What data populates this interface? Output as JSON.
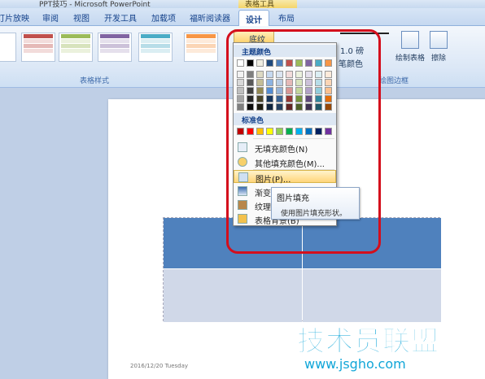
{
  "titlebar": {
    "title": "PPT技巧 - Microsoft PowerPoint",
    "contextual_tab_group": "表格工具"
  },
  "tabs": [
    "灯片放映",
    "审阅",
    "视图",
    "开发工具",
    "加载项",
    "福昕阅读器",
    "设计",
    "布局"
  ],
  "active_tab": "设计",
  "ribbon": {
    "table_styles_label": "表格样式",
    "shading_button": "底纹",
    "pen_weight": "1.0 磅",
    "pen_color": "笔颜色",
    "draw_table": "绘制表格",
    "eraser": "擦除",
    "draw_borders_label": "绘图边框"
  },
  "shading_menu": {
    "theme_colors_heading": "主题颜色",
    "theme_colors": [
      [
        "#ffffff",
        "#000000",
        "#eeece1",
        "#1f497d",
        "#4f81bd",
        "#c0504d",
        "#9bbb59",
        "#8064a2",
        "#4bacc6",
        "#f79646"
      ],
      [
        "#f2f2f2",
        "#7f7f7f",
        "#ddd9c3",
        "#c6d9f0",
        "#dbe5f1",
        "#f2dcdb",
        "#ebf1dd",
        "#e5e0ec",
        "#dbeef3",
        "#fdeada"
      ],
      [
        "#d8d8d8",
        "#595959",
        "#c4bd97",
        "#8db3e2",
        "#b8cce4",
        "#e5b9b7",
        "#d7e3bc",
        "#ccc1d9",
        "#b7dde8",
        "#fbd5b5"
      ],
      [
        "#bfbfbf",
        "#3f3f3f",
        "#938953",
        "#548dd4",
        "#95b3d7",
        "#d99694",
        "#c3d69b",
        "#b2a2c7",
        "#92cddc",
        "#fac08f"
      ],
      [
        "#a5a5a5",
        "#262626",
        "#494429",
        "#17365d",
        "#366092",
        "#953734",
        "#76923c",
        "#5f497a",
        "#31859b",
        "#e36c09"
      ],
      [
        "#7f7f7f",
        "#0c0c0c",
        "#1d1b10",
        "#0f243e",
        "#244061",
        "#632423",
        "#4f6128",
        "#3f3151",
        "#205867",
        "#974806"
      ]
    ],
    "standard_colors_heading": "标准色",
    "standard_colors": [
      "#c00000",
      "#ff0000",
      "#ffc000",
      "#ffff00",
      "#92d050",
      "#00b050",
      "#00b0f0",
      "#0070c0",
      "#002060",
      "#7030a0"
    ],
    "items": [
      {
        "label": "无填充颜色(N)",
        "icon": "no-fill-icon"
      },
      {
        "label": "其他填充颜色(M)...",
        "icon": "color-wheel-icon"
      },
      {
        "label": "图片(P)...",
        "icon": "picture-icon",
        "highlighted": true
      },
      {
        "label": "渐变(G)",
        "icon": "gradient-icon"
      },
      {
        "label": "纹理(T)",
        "icon": "texture-icon"
      },
      {
        "label": "表格背景(B)",
        "icon": "table-background-icon"
      }
    ]
  },
  "tooltip": {
    "title": "图片填充",
    "description": "使用图片填充形状。"
  },
  "slide": {
    "footer_date": "2016/12/20 Tuesday"
  },
  "watermark": {
    "name": "技术员联盟",
    "url": "www.jsgho.com"
  },
  "colors": {
    "table_header": "#4f81bd",
    "table_body": "#d0d8e8",
    "annotation": "#d40e1c",
    "watermark": "#11a6d8"
  }
}
